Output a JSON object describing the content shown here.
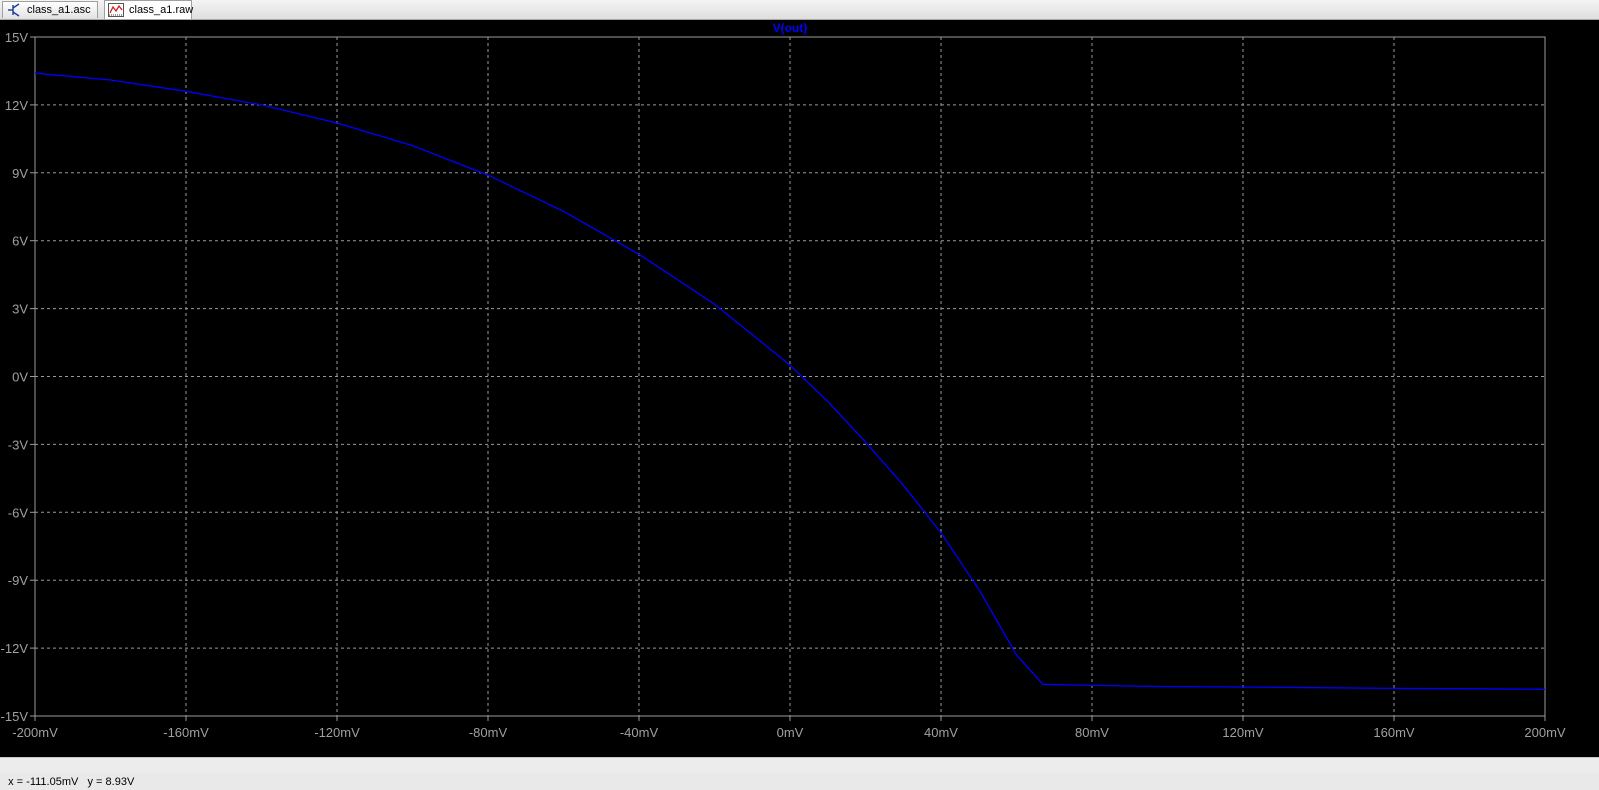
{
  "tabs": [
    {
      "label": "class_a1.asc",
      "icon": "schematic-icon",
      "active": false
    },
    {
      "label": "class_a1.raw",
      "icon": "waveform-icon",
      "active": true
    }
  ],
  "status": {
    "cursor_readout": "x = -111.05mV   y = 8.93V"
  },
  "colors": {
    "background": "#000000",
    "grid": "#9a9a9a",
    "trace": "#0000ff",
    "tick_label": "#a0a0a0"
  },
  "chart_data": {
    "type": "line",
    "title": "V(out)",
    "xlabel": "",
    "ylabel": "",
    "xlim": [
      -200,
      200
    ],
    "ylim": [
      -15,
      15
    ],
    "x_unit": "mV",
    "y_unit": "V",
    "grid": true,
    "x_ticks": [
      "-200mV",
      "-160mV",
      "-120mV",
      "-80mV",
      "-40mV",
      "0mV",
      "40mV",
      "80mV",
      "120mV",
      "160mV",
      "200mV"
    ],
    "y_ticks": [
      "15V",
      "12V",
      "9V",
      "6V",
      "3V",
      "0V",
      "-3V",
      "-6V",
      "-9V",
      "-12V",
      "-15V"
    ],
    "series": [
      {
        "name": "V(out)",
        "x": [
          -200,
          -180,
          -160,
          -140,
          -120,
          -100,
          -80,
          -60,
          -40,
          -20,
          0,
          10,
          20,
          30,
          40,
          50,
          60,
          67,
          80,
          100,
          120,
          140,
          160,
          180,
          200
        ],
        "y": [
          13.4,
          13.1,
          12.6,
          12.0,
          11.2,
          10.2,
          8.9,
          7.3,
          5.4,
          3.2,
          0.5,
          -1.1,
          -2.9,
          -4.8,
          -6.9,
          -9.4,
          -12.3,
          -13.6,
          -13.65,
          -13.7,
          -13.72,
          -13.75,
          -13.78,
          -13.8,
          -13.82
        ]
      }
    ]
  }
}
